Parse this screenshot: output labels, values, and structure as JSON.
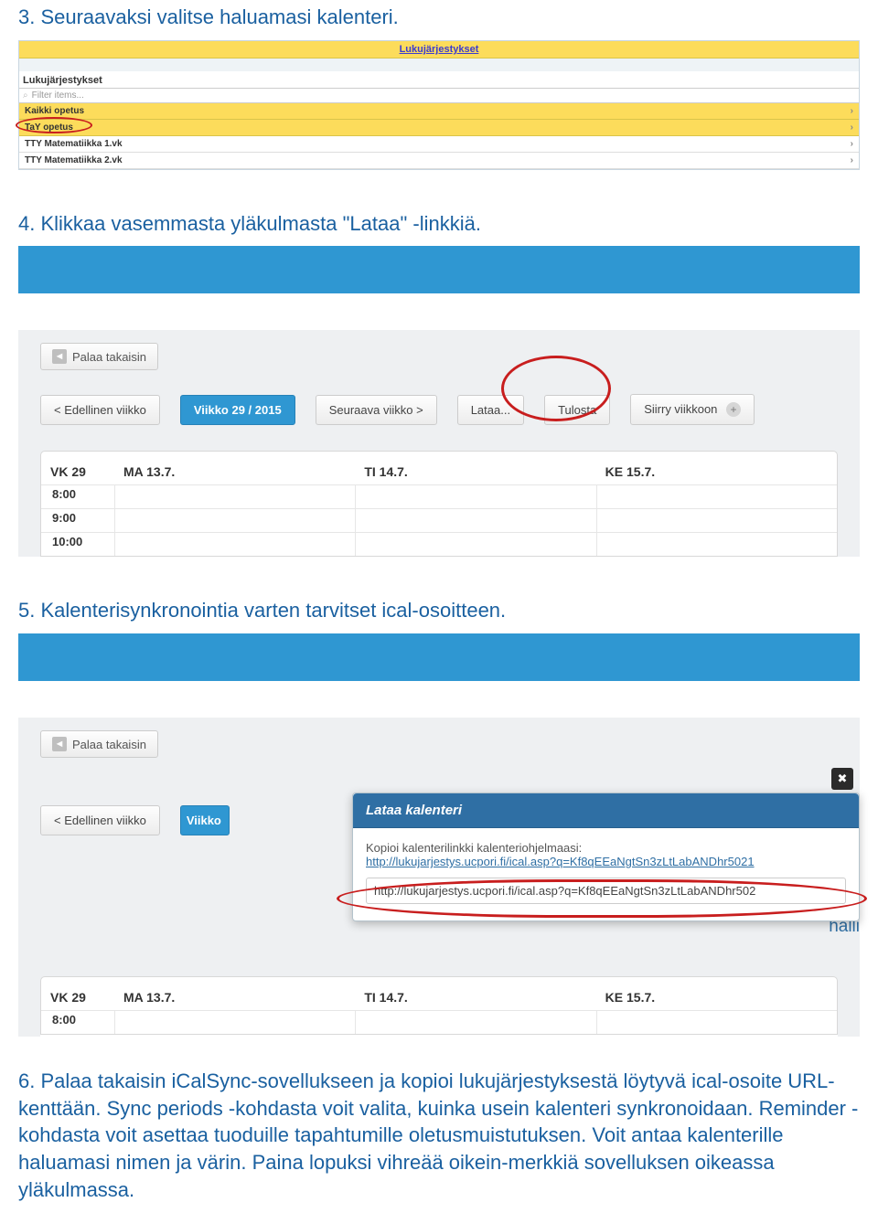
{
  "step3": {
    "text": "3.  Seuraavaksi valitse haluamasi kalenteri."
  },
  "step4": {
    "text": "4.  Klikkaa vasemmasta yläkulmasta \"Lataa\" -linkkiä."
  },
  "step5": {
    "text": "5.  Kalenterisynkronointia varten tarvitset ical-osoitteen."
  },
  "step6": {
    "text": "6.  Palaa takaisin iCalSync-sovellukseen ja kopioi lukujärjestyksestä löytyvä ical-osoite URL-kenttään. Sync periods -kohdasta voit valita, kuinka usein kalenteri synkronoidaan. Reminder -kohdasta voit asettaa tuoduille tapahtumille oletusmuistutuksen. Voit antaa kalenterille haluamasi nimen ja värin. Paina lopuksi vihreää oikein-merkkiä sovelluksen oikeassa yläkulmassa."
  },
  "shot1": {
    "tab_header": "Lukujärjestykset",
    "panel_title": "Lukujärjestykset",
    "filter_placeholder": "Filter items...",
    "rows": {
      "r0": "Kaikki opetus",
      "r1": "TaY opetus",
      "r2": "TTY Matematiikka 1.vk",
      "r3": "TTY Matematiikka 2.vk"
    }
  },
  "shot2": {
    "back": "Palaa takaisin",
    "prev": "< Edellinen viikko",
    "current": "Viikko 29 / 2015",
    "next": "Seuraava viikko >",
    "download": "Lataa...",
    "print": "Tulosta",
    "goto": "Siirry viikkoon",
    "head": {
      "wk": "VK 29",
      "d1": "MA 13.7.",
      "d2": "TI 14.7.",
      "d3": "KE 15.7."
    },
    "times": {
      "t1": "8:00",
      "t2": "9:00",
      "t3": "10:00"
    }
  },
  "shot3": {
    "back": "Palaa takaisin",
    "prev": "< Edellinen viikko",
    "current_short": "Viikko",
    "modal_title": "Lataa kalenteri",
    "modal_desc": "Kopioi kalenterilinkki kalenteriohjelmaasi:",
    "modal_link": "http://lukujarjestys.ucpori.fi/ical.asp?q=Kf8qEEaNgtSn3zLtLabANDhr5021",
    "modal_input": "http://lukujarjestys.ucpori.fi/ical.asp?q=Kf8qEEaNgtSn3zLtLabANDhr502",
    "partial_right": "halli",
    "head": {
      "wk": "VK 29",
      "d1": "MA 13.7.",
      "d2": "TI 14.7.",
      "d3": "KE 15.7."
    },
    "times": {
      "t1": "8:00"
    }
  }
}
